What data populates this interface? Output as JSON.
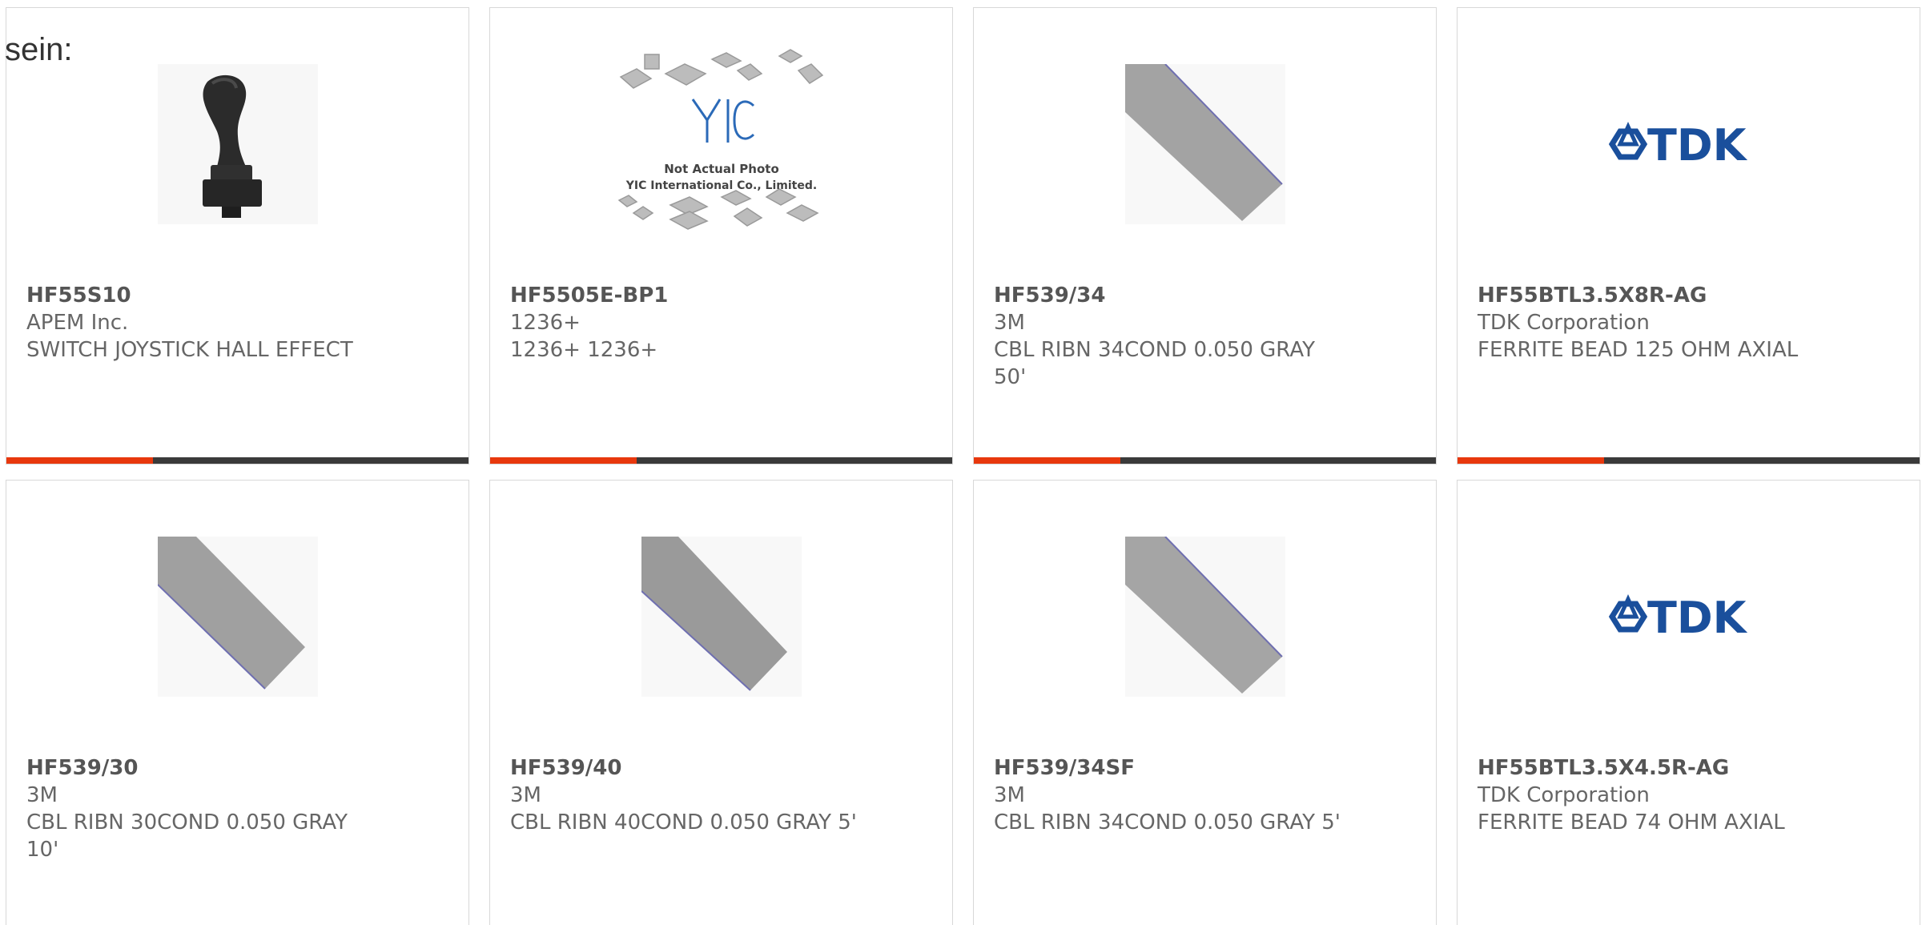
{
  "intro_text": "sein:",
  "colors": {
    "accent": "#e8380d",
    "bar": "#3a3a3a",
    "border": "#d8d8d8",
    "tdk_blue": "#1a4f9c"
  },
  "products": [
    {
      "part_number": "HF55S10",
      "manufacturer": "APEM Inc.",
      "description": "SWITCH JOYSTICK HALL EFFECT",
      "image": "joystick-photo"
    },
    {
      "part_number": "HF5505E-BP1",
      "manufacturer": "1236+",
      "description": "1236+ 1236+",
      "image": "placeholder-photo",
      "image_text": {
        "logo": "YIC",
        "line1": "Not Actual Photo",
        "line2": "YIC International Co., Limited."
      }
    },
    {
      "part_number": "HF539/34",
      "manufacturer": "3M",
      "description": "CBL RIBN 34COND 0.050 GRAY 50'",
      "image": "ribbon-cable-photo"
    },
    {
      "part_number": "HF55BTL3.5X8R-AG",
      "manufacturer": "TDK Corporation",
      "description": "FERRITE BEAD 125 OHM AXIAL",
      "image": "tdk-logo",
      "image_text": {
        "logo": "TDK"
      }
    },
    {
      "part_number": "HF539/30",
      "manufacturer": "3M",
      "description": "CBL RIBN 30COND 0.050 GRAY 10'",
      "image": "ribbon-cable-photo"
    },
    {
      "part_number": "HF539/40",
      "manufacturer": "3M",
      "description": "CBL RIBN 40COND 0.050 GRAY 5'",
      "image": "ribbon-cable-photo"
    },
    {
      "part_number": "HF539/34SF",
      "manufacturer": "3M",
      "description": "CBL RIBN 34COND 0.050 GRAY 5'",
      "image": "ribbon-cable-photo"
    },
    {
      "part_number": "HF55BTL3.5X4.5R-AG",
      "manufacturer": "TDK Corporation",
      "description": "FERRITE BEAD 74 OHM AXIAL",
      "image": "tdk-logo",
      "image_text": {
        "logo": "TDK"
      }
    }
  ]
}
